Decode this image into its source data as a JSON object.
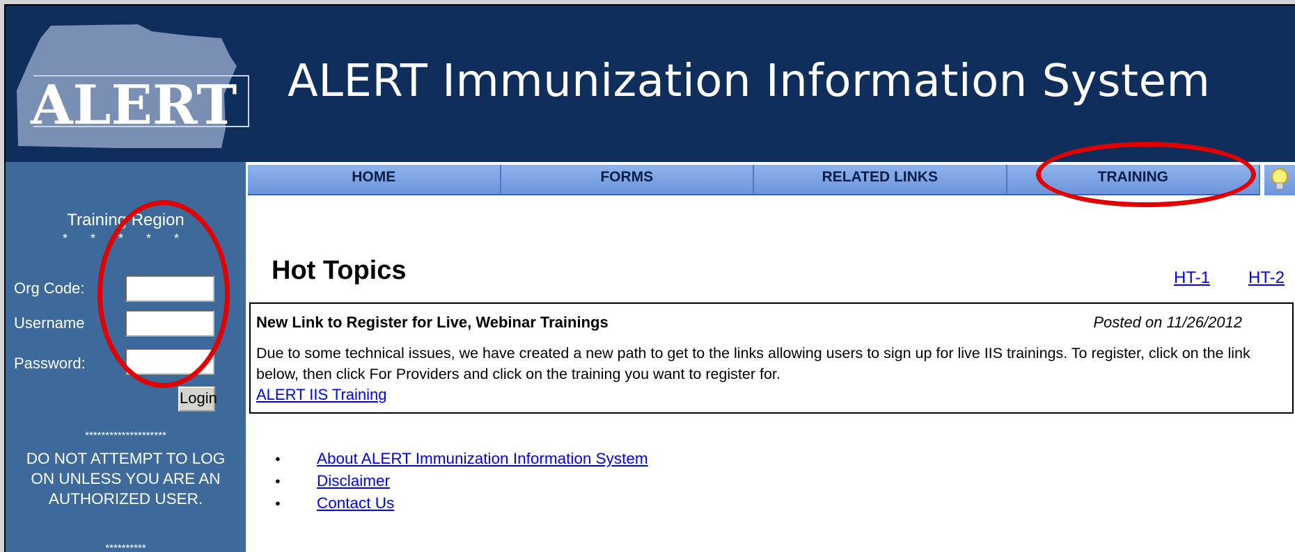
{
  "header": {
    "logo_text": "ALERT",
    "title": "ALERT Immunization Information System"
  },
  "nav": {
    "tabs": [
      "HOME",
      "FORMS",
      "RELATED LINKS",
      "TRAINING"
    ],
    "hint_icon": "lightbulb-icon"
  },
  "sidebar": {
    "region_label": "Training Region",
    "region_stars": "* * * * *",
    "org_code_label": "Org Code:",
    "username_label": "Username",
    "password_label": "Password:",
    "org_code_value": "",
    "username_value": "",
    "password_value": "",
    "login_label": "Login",
    "warning_stars_top": "********************",
    "warning_text": "DO NOT ATTEMPT TO LOG ON UNLESS YOU ARE AN AUTHORIZED USER.",
    "warning_stars_bottom": "**********"
  },
  "main": {
    "hot_topics_title": "Hot Topics",
    "ht_links": [
      "HT-1",
      "HT-2"
    ],
    "news": {
      "title": "New Link to Register for Live, Webinar Trainings",
      "date": "Posted on 11/26/2012",
      "body": "Due to some technical issues, we have created a new path to get to the links allowing users to sign up for live IIS trainings. To register, click on the link below, then click For Providers and click on the training you want to register for.",
      "link": "ALERT IIS Training"
    },
    "links": [
      "About ALERT Immunization Information System",
      "Disclaimer",
      "Contact Us"
    ]
  },
  "colors": {
    "header_bg": "#0f2e5c",
    "sidebar_bg": "#3d6a9a",
    "nav_bg": "#7fa6e6",
    "annotation_red": "#e00000",
    "link": "#0000ee"
  }
}
